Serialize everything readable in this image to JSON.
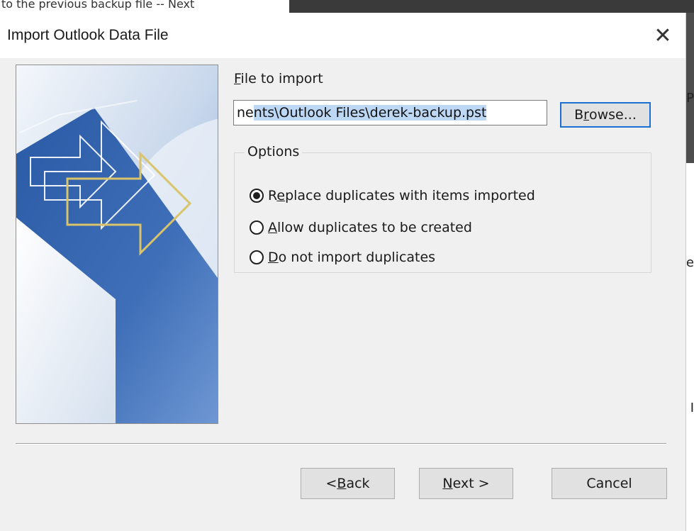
{
  "background": {
    "caption": "to the previous backup file -- Next",
    "edge_glyph_1": "P",
    "edge_glyph_2": "e",
    "edge_glyph_3": "I"
  },
  "dialog": {
    "title": "Import Outlook Data File",
    "close_glyph": "✕"
  },
  "file": {
    "label_first": "F",
    "label_rest": "ile to import",
    "value_visible_prefix": "ne",
    "value_visible_selected": "nts\\Outlook Files\\derek-backup.pst",
    "browse_first": "B",
    "browse_u": "r",
    "browse_rest": "owse..."
  },
  "options": {
    "legend": "Options",
    "items": [
      {
        "pre": "R",
        "u": "e",
        "rest": "place duplicates with items imported",
        "checked": true
      },
      {
        "pre": "",
        "u": "A",
        "rest": "llow duplicates to be created",
        "checked": false
      },
      {
        "pre": "",
        "u": "D",
        "rest": "o not import duplicates",
        "checked": false
      }
    ]
  },
  "buttons": {
    "back_pre": "< ",
    "back_u": "B",
    "back_rest": "ack",
    "next_u": "N",
    "next_rest": "ext >",
    "cancel": "Cancel"
  },
  "colors": {
    "selection": "#bcd8f5",
    "focus_border": "#1b6fd1",
    "dialog_bg": "#f0f0f0"
  }
}
